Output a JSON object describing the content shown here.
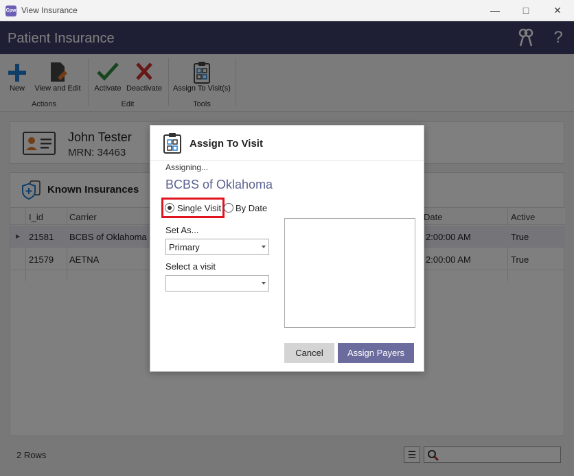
{
  "window": {
    "title": "View Insurance",
    "app_icon_text": "Cpw"
  },
  "header": {
    "title": "Patient Insurance"
  },
  "ribbon": {
    "groups": [
      {
        "label": "Actions",
        "buttons": [
          "New",
          "View and Edit"
        ]
      },
      {
        "label": "Edit",
        "buttons": [
          "Activate",
          "Deactivate"
        ]
      },
      {
        "label": "Tools",
        "buttons": [
          "Assign To Visit(s)"
        ]
      }
    ]
  },
  "patient": {
    "name": "John Tester",
    "mrn": "MRN: 34463"
  },
  "insurances": {
    "title": "Known Insurances",
    "columns": [
      "I_id",
      "Carrier",
      "Date",
      "Active"
    ],
    "rows": [
      {
        "id": "21581",
        "carrier": "BCBS of Oklahoma",
        "date": "2:00:00 AM",
        "active": "True"
      },
      {
        "id": "21579",
        "carrier": "AETNA",
        "date": "2:00:00 AM",
        "active": "True"
      }
    ]
  },
  "status": {
    "rows": "2 Rows"
  },
  "dialog": {
    "title": "Assign To Visit",
    "assigning": "Assigning...",
    "payer": "BCBS of Oklahoma",
    "radio_single": "Single Visit",
    "radio_date": "By Date",
    "selected_mode": "Single Visit",
    "set_as_label": "Set As...",
    "set_as_value": "Primary",
    "visit_label": "Select a visit",
    "visit_value": "",
    "cancel": "Cancel",
    "assign": "Assign Payers"
  },
  "colors": {
    "header": "#3d3f6b",
    "accent": "#6b6b9e",
    "payer_text": "#5b6191",
    "highlight": "#e0141e",
    "new_icon": "#1e7fd0",
    "activate_icon": "#2e8b3e",
    "deactivate_icon": "#d23030"
  }
}
